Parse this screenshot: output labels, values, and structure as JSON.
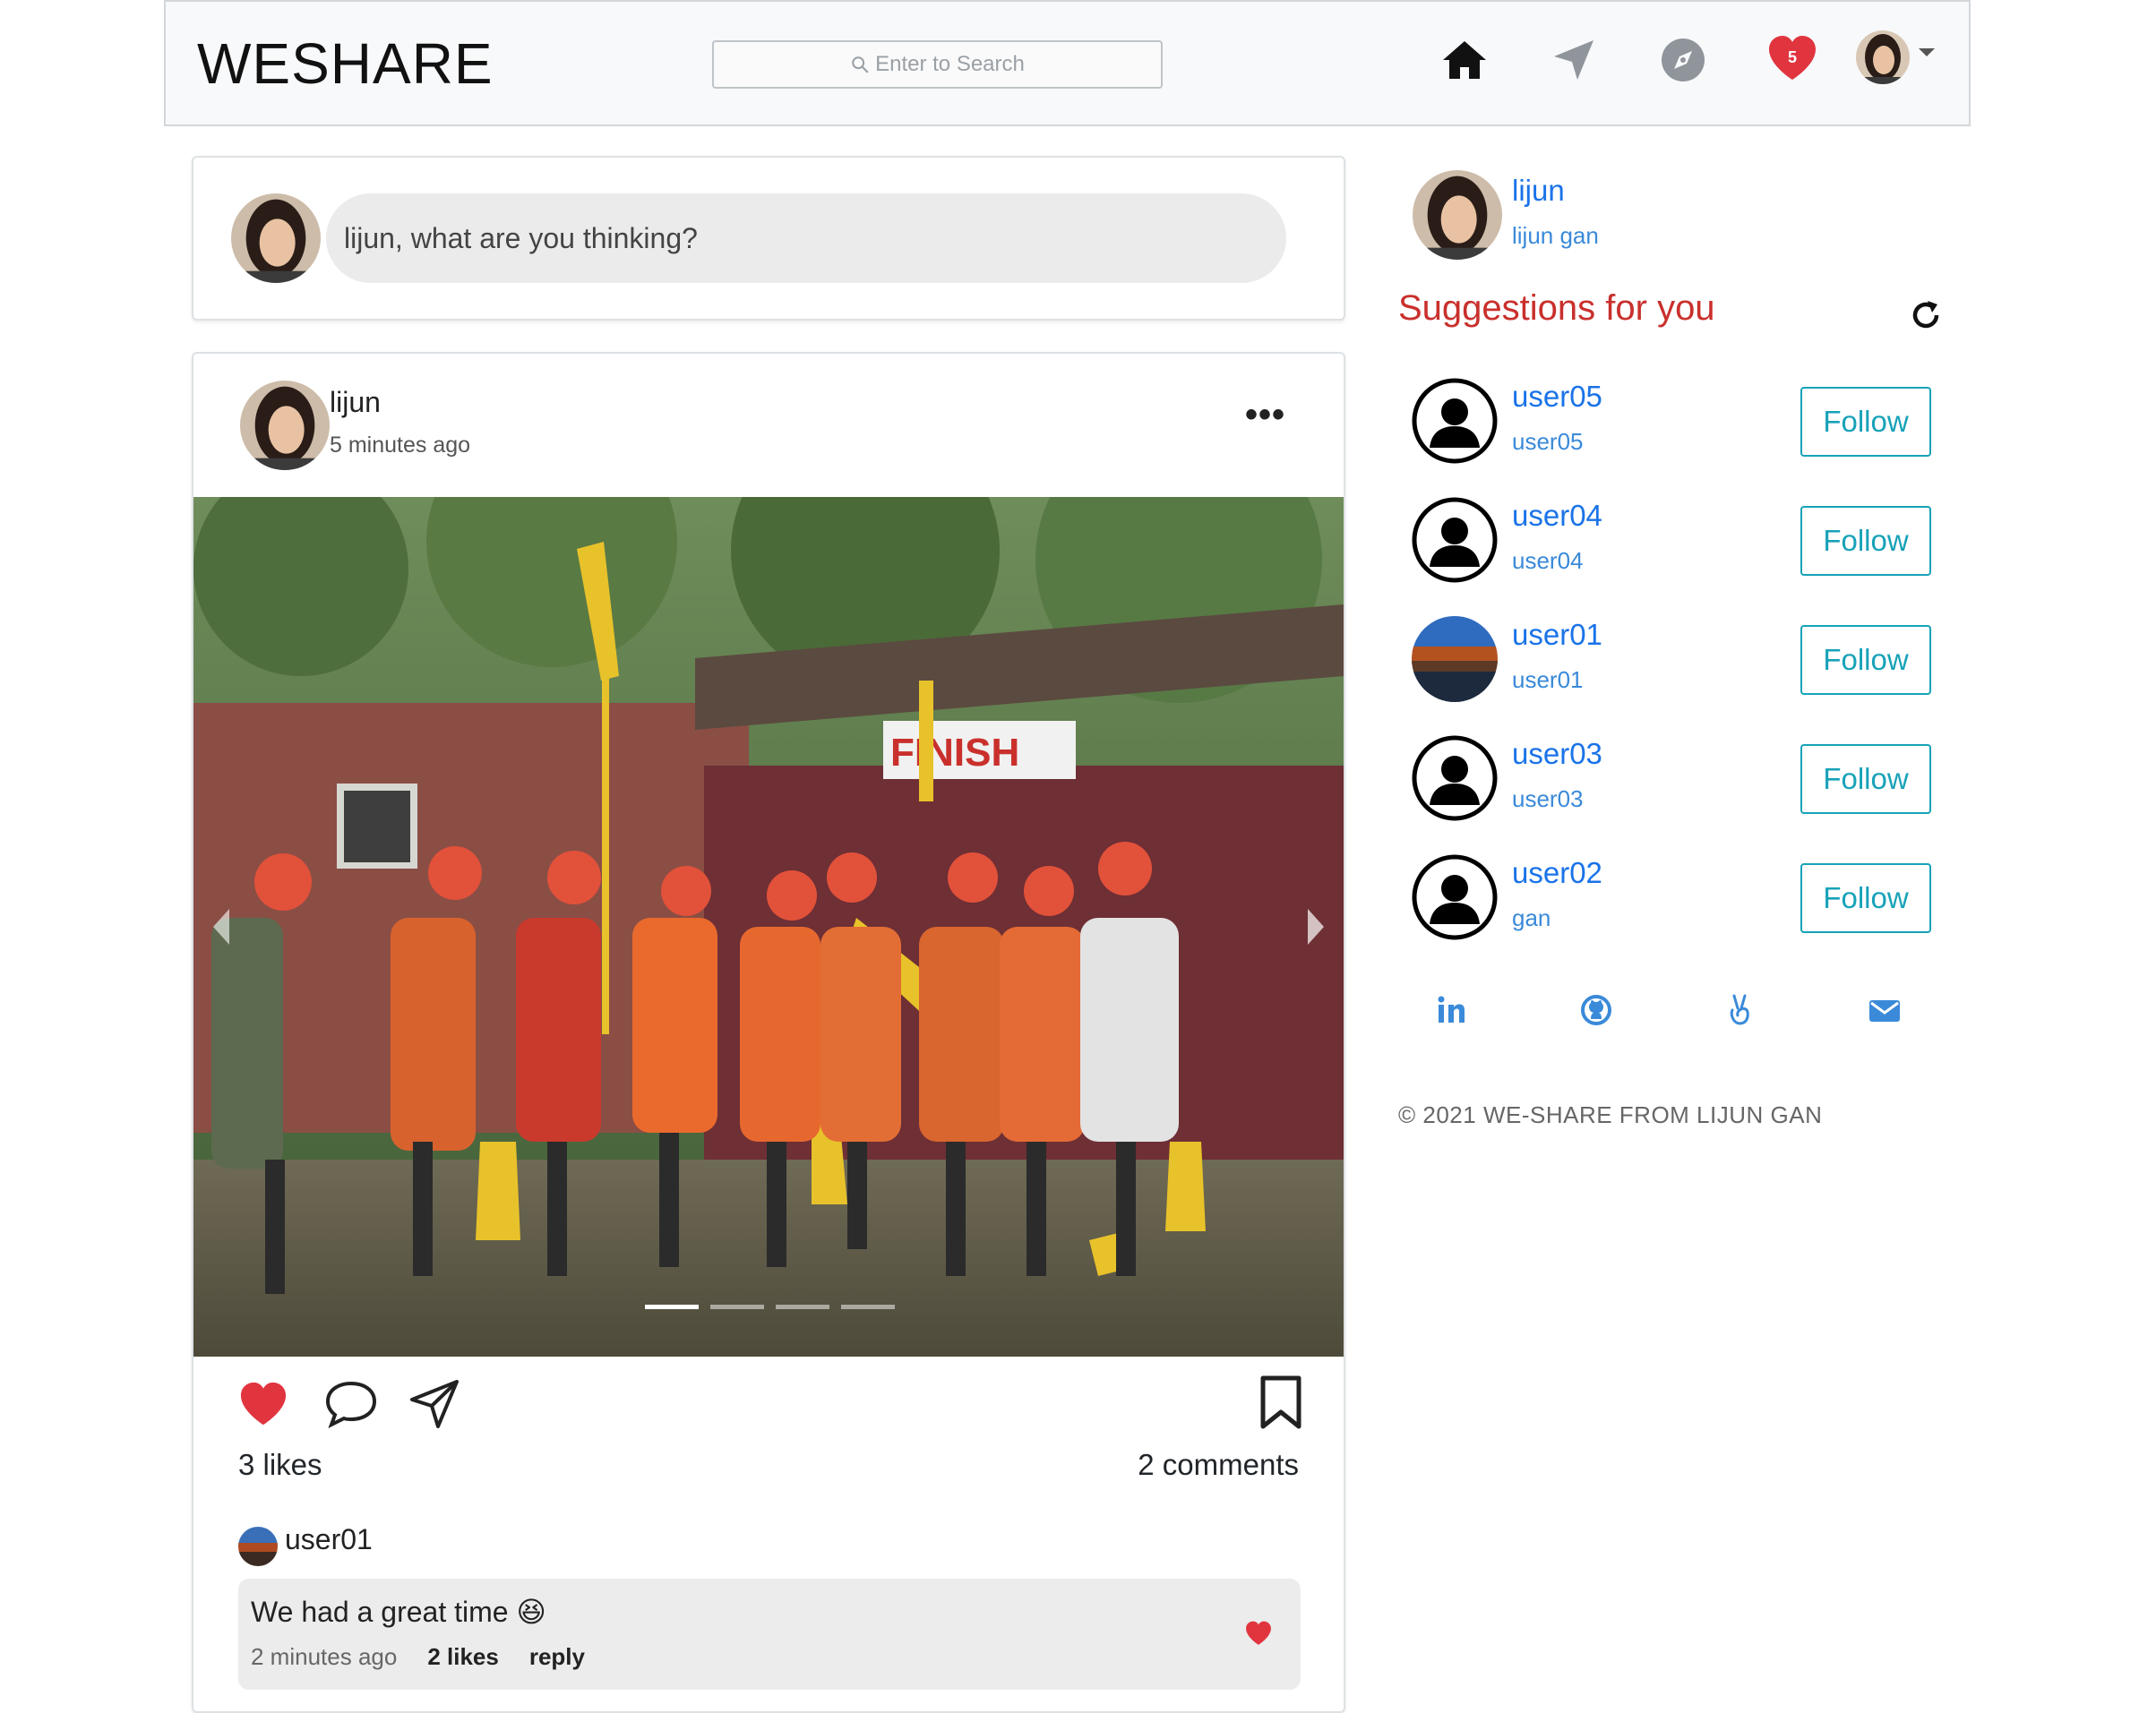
{
  "app": {
    "brand": "WESHARE"
  },
  "search": {
    "placeholder": "Enter to Search"
  },
  "nav": {
    "notification_count": "5"
  },
  "composer": {
    "prompt": "lijun, what are you thinking?"
  },
  "post": {
    "username": "lijun",
    "time": "5 minutes ago",
    "likes": "3 likes",
    "comments": "2 comments",
    "photo_banner": "FINISH",
    "carousel": {
      "slides": 4,
      "active": 0
    }
  },
  "comment": {
    "username": "user01",
    "text": "We had a great time 😆",
    "time": "2 minutes ago",
    "likes": "2 likes",
    "reply": "reply"
  },
  "sidebar": {
    "profile": {
      "username": "lijun",
      "fullname": "lijun gan"
    },
    "suggestions_title": "Suggestions for you",
    "follow_label": "Follow",
    "suggestions": [
      {
        "username": "user05",
        "subtitle": "user05"
      },
      {
        "username": "user04",
        "subtitle": "user04"
      },
      {
        "username": "user01",
        "subtitle": "user01"
      },
      {
        "username": "user03",
        "subtitle": "user03"
      },
      {
        "username": "user02",
        "subtitle": "gan"
      }
    ],
    "social_icons": [
      "linkedin-icon",
      "github-icon",
      "angellist-icon",
      "mail-icon"
    ],
    "footer": "© 2021 WE-SHARE FROM LIJUN GAN"
  },
  "colors": {
    "accent": "#17a2b8",
    "link": "#1a73e8",
    "heart": "#e0353f",
    "title_red": "#c9302c"
  }
}
